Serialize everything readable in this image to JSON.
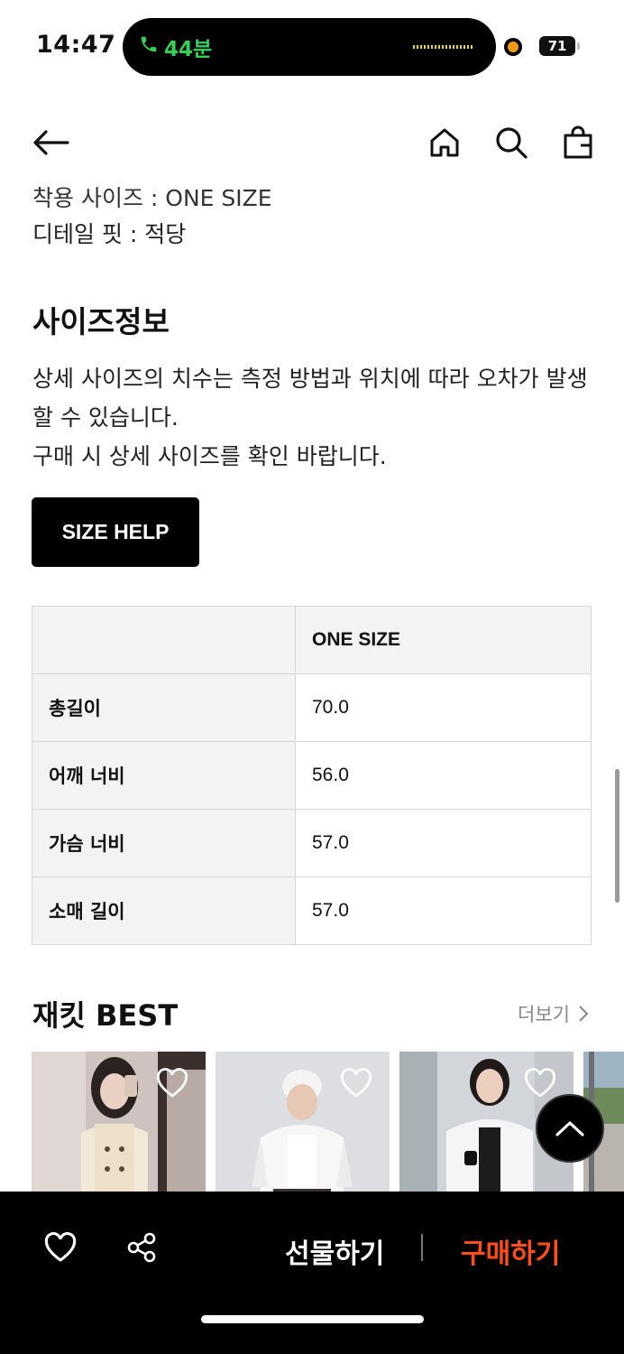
{
  "status_bar": {
    "time": "14:47",
    "call_duration": "44분",
    "battery": "71"
  },
  "header": {
    "back_icon": "arrow-left-icon",
    "home_icon": "home-icon",
    "search_icon": "search-icon",
    "bag_icon": "shopping-bag-icon"
  },
  "content": {
    "partial_line": "착용 사이즈 : ONE SIZE",
    "detail_fit": "디테일 핏 : 적당",
    "size_info_title": "사이즈정보",
    "size_info_desc_1": "상세 사이즈의 치수는 측정 방법과 위치에 따라 오차가 발생할 수 있습니다.",
    "size_info_desc_2": "구매 시 상세 사이즈를 확인 바랍니다.",
    "size_help_label": "SIZE HELP"
  },
  "size_table": {
    "column": "ONE SIZE",
    "rows": [
      {
        "label": "총길이",
        "value": "70.0"
      },
      {
        "label": "어깨 너비",
        "value": "56.0"
      },
      {
        "label": "가슴 너비",
        "value": "57.0"
      },
      {
        "label": "소매 길이",
        "value": "57.0"
      }
    ]
  },
  "best": {
    "title": "재킷 BEST",
    "more_label": "더보기"
  },
  "bottom_bar": {
    "gift_label": "선물하기",
    "buy_label": "구매하기"
  },
  "colors": {
    "accent": "#ff4d1c",
    "call_green": "#35d05a",
    "button_bg": "#000000"
  }
}
